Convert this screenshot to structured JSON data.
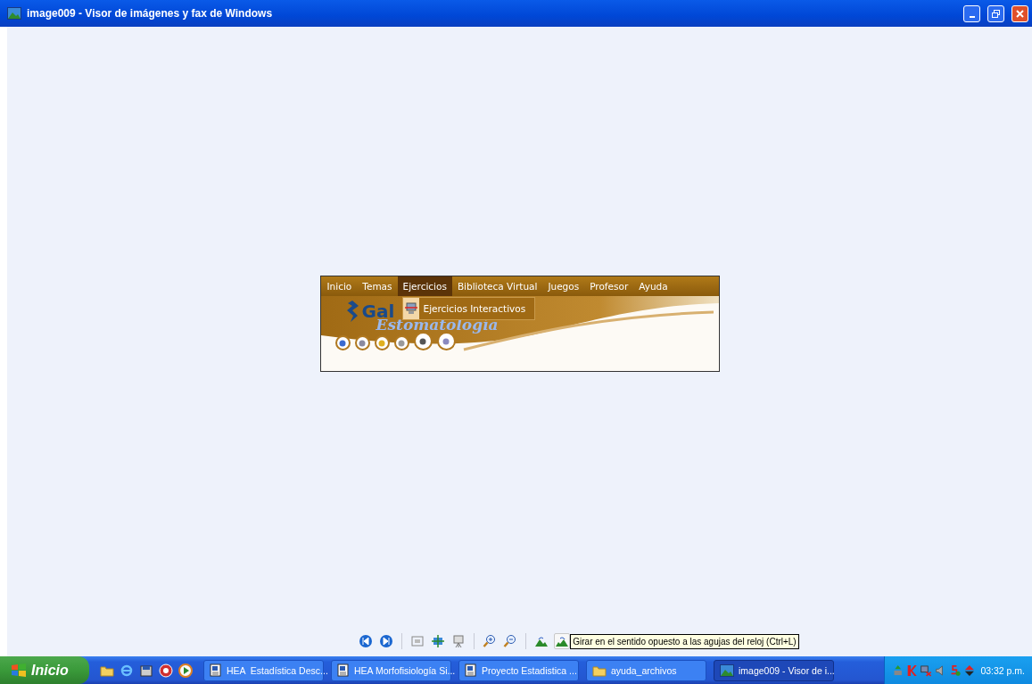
{
  "window": {
    "title": "image009 - Visor de imágenes y fax de Windows"
  },
  "image": {
    "menu": [
      {
        "label": "Inicio",
        "selected": false
      },
      {
        "label": "Temas",
        "selected": false
      },
      {
        "label": "Ejercicios",
        "selected": true
      },
      {
        "label": "Biblioteca Virtual",
        "selected": false
      },
      {
        "label": "Juegos",
        "selected": false
      },
      {
        "label": "Profesor",
        "selected": false
      },
      {
        "label": "Ayuda",
        "selected": false
      }
    ],
    "dropdown": [
      "Ejercicios Interactivos"
    ],
    "logo": {
      "name": "Gal",
      "subtitle": "Estomatología"
    }
  },
  "toolbar": {
    "tooltip": "Girar en el sentido opuesto a las agujas del reloj (Ctrl+L)"
  },
  "taskbar": {
    "start": "Inicio",
    "tasks": [
      {
        "label": "HEA  Estadística Desc...",
        "kind": "document",
        "selected": false
      },
      {
        "label": "HEA Morfofisiología Si...",
        "kind": "document",
        "selected": false
      },
      {
        "label": "Proyecto Estadistica ...",
        "kind": "document",
        "selected": false
      },
      {
        "label": "ayuda_archivos",
        "kind": "folder",
        "selected": false
      },
      {
        "label": "image009 - Visor de i...",
        "kind": "picture",
        "selected": true
      }
    ],
    "clock": "03:32 p.m."
  }
}
